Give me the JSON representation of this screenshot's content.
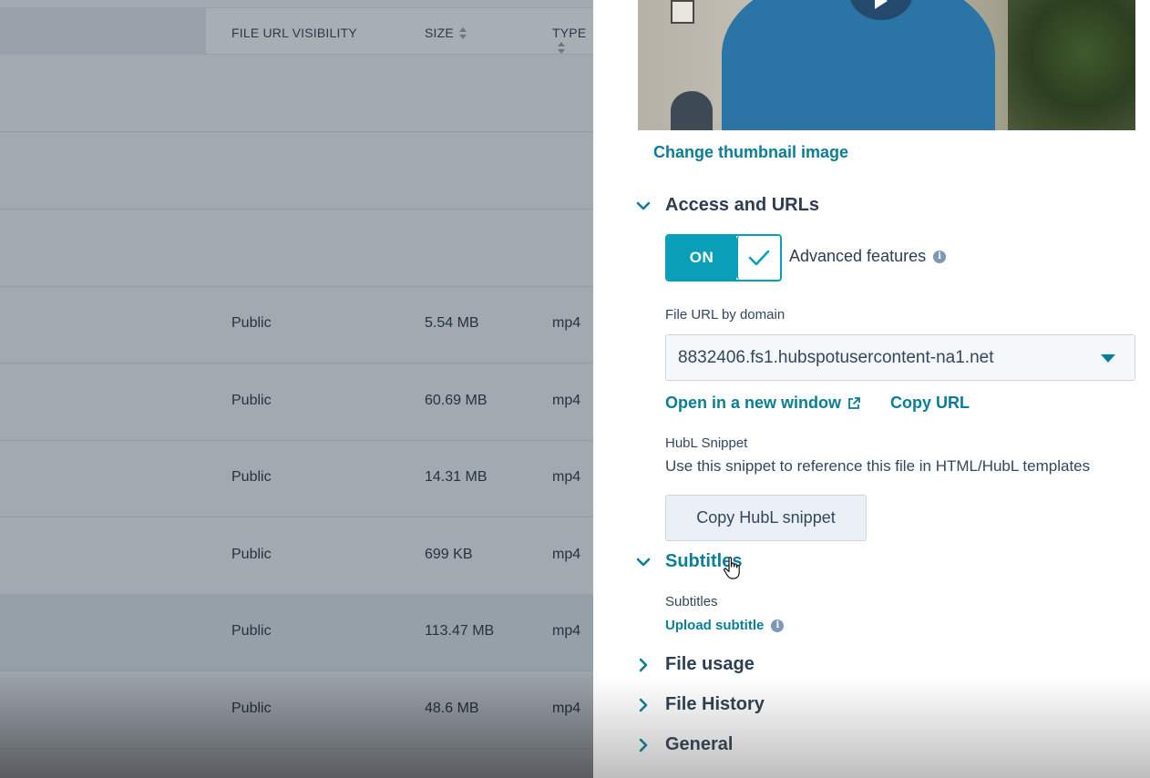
{
  "table": {
    "columns": {
      "visibility": "FILE URL VISIBILITY",
      "size": "SIZE",
      "type": "TYPE"
    },
    "rows": [
      {
        "visibility": "",
        "size": "",
        "type": ""
      },
      {
        "visibility": "",
        "size": "",
        "type": ""
      },
      {
        "visibility": "",
        "size": "",
        "type": ""
      },
      {
        "visibility": "Public",
        "size": "5.54 MB",
        "type": "mp4"
      },
      {
        "visibility": "Public",
        "size": "60.69 MB",
        "type": "mp4"
      },
      {
        "visibility": "Public",
        "size": "14.31 MB",
        "type": "mp4"
      },
      {
        "visibility": "Public",
        "size": "699 KB",
        "type": "mp4"
      },
      {
        "visibility": "Public",
        "size": "113.47 MB",
        "type": "mp4"
      },
      {
        "visibility": "Public",
        "size": "48.6 MB",
        "type": "mp4"
      }
    ]
  },
  "panel": {
    "change_thumbnail": "Change thumbnail image",
    "access": {
      "title": "Access and URLs",
      "toggle_label": "ON",
      "advanced_label": "Advanced features",
      "file_url_label": "File URL by domain",
      "domain_value": "8832406.fs1.hubspotusercontent-na1.net",
      "open_window": "Open in a new window",
      "copy_url": "Copy URL",
      "hubl_label": "HubL Snippet",
      "hubl_desc": "Use this snippet to reference this file in HTML/HubL templates",
      "copy_hubl": "Copy HubL snippet"
    },
    "subtitles": {
      "title": "Subtitles",
      "label": "Subtitles",
      "upload": "Upload subtitle"
    },
    "file_usage": {
      "title": "File usage"
    },
    "file_history": {
      "title": "File History"
    },
    "general": {
      "title": "General"
    }
  },
  "colors": {
    "accent": "#0a9fb8",
    "link": "#0a7e95",
    "text": "#33475b",
    "overlay": "#a2a9b0"
  },
  "icons": [
    "play-icon",
    "chevron-down-icon",
    "chevron-right-icon",
    "check-icon",
    "info-icon",
    "external-link-icon",
    "dropdown-caret-icon",
    "sort-icon",
    "hand-cursor-icon"
  ]
}
